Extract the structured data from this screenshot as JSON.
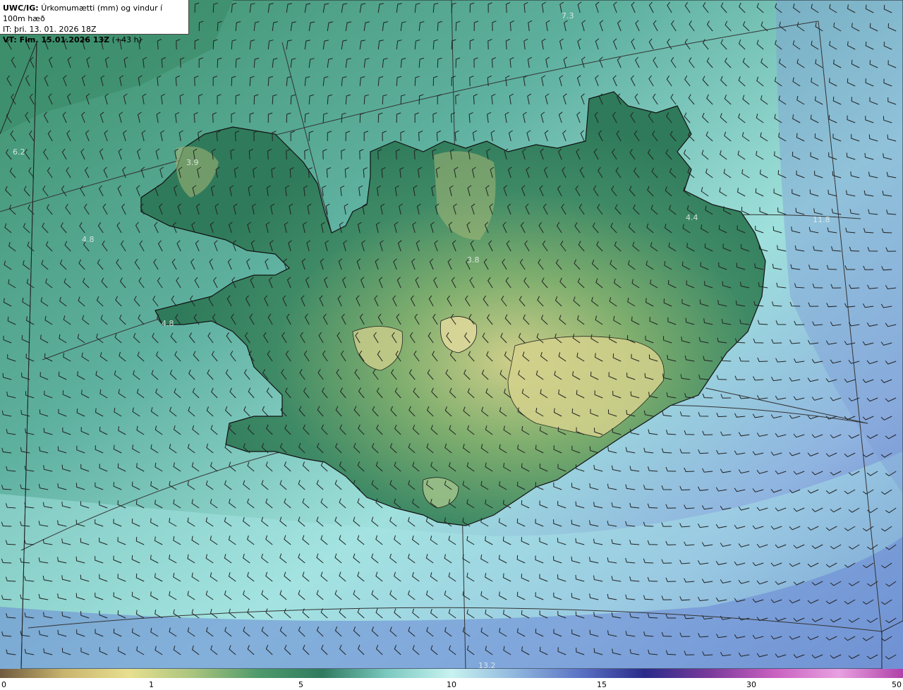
{
  "header": {
    "model": "UWC/IG:",
    "description": "Úrkomumætti (mm) og vindur í 100m hæð",
    "it_label": "IT:",
    "it_value": "þri. 13. 01. 2026 18Z",
    "vt_label": "VT: Fim. 15.01.2026 13Z",
    "vt_lead": "(+43 h)"
  },
  "map_values": [
    {
      "id": "v1",
      "text": "7.3"
    },
    {
      "id": "v2",
      "text": "6.2"
    },
    {
      "id": "v3",
      "text": "3.9"
    },
    {
      "id": "v4",
      "text": "4.8"
    },
    {
      "id": "v5",
      "text": "4.8"
    },
    {
      "id": "v6",
      "text": "3.8"
    },
    {
      "id": "v7",
      "text": "4.4"
    },
    {
      "id": "v8",
      "text": "11.8"
    },
    {
      "id": "v9",
      "text": "13.2"
    }
  ],
  "colorbar": {
    "ticks": [
      "0",
      "1",
      "5",
      "10",
      "15",
      "30",
      "50"
    ],
    "colors": [
      "#6f5a3e",
      "#c9b56e",
      "#e7df8f",
      "#a9c47e",
      "#4f9a6b",
      "#2e7a5f",
      "#7cc9c0",
      "#c7f2f0",
      "#8fb6dd",
      "#5a72c4",
      "#2a2a8a",
      "#7a3a9a",
      "#c860c0",
      "#e8a0e0",
      "#b040a8"
    ]
  },
  "colors": {
    "land_low": "#3f8a66",
    "land_high": "#c8c880",
    "sea_near": "#6cc0b0",
    "sea_far": "#6f8fd0",
    "coast": "#111111",
    "grid": "#333333",
    "barb": "#222222"
  }
}
